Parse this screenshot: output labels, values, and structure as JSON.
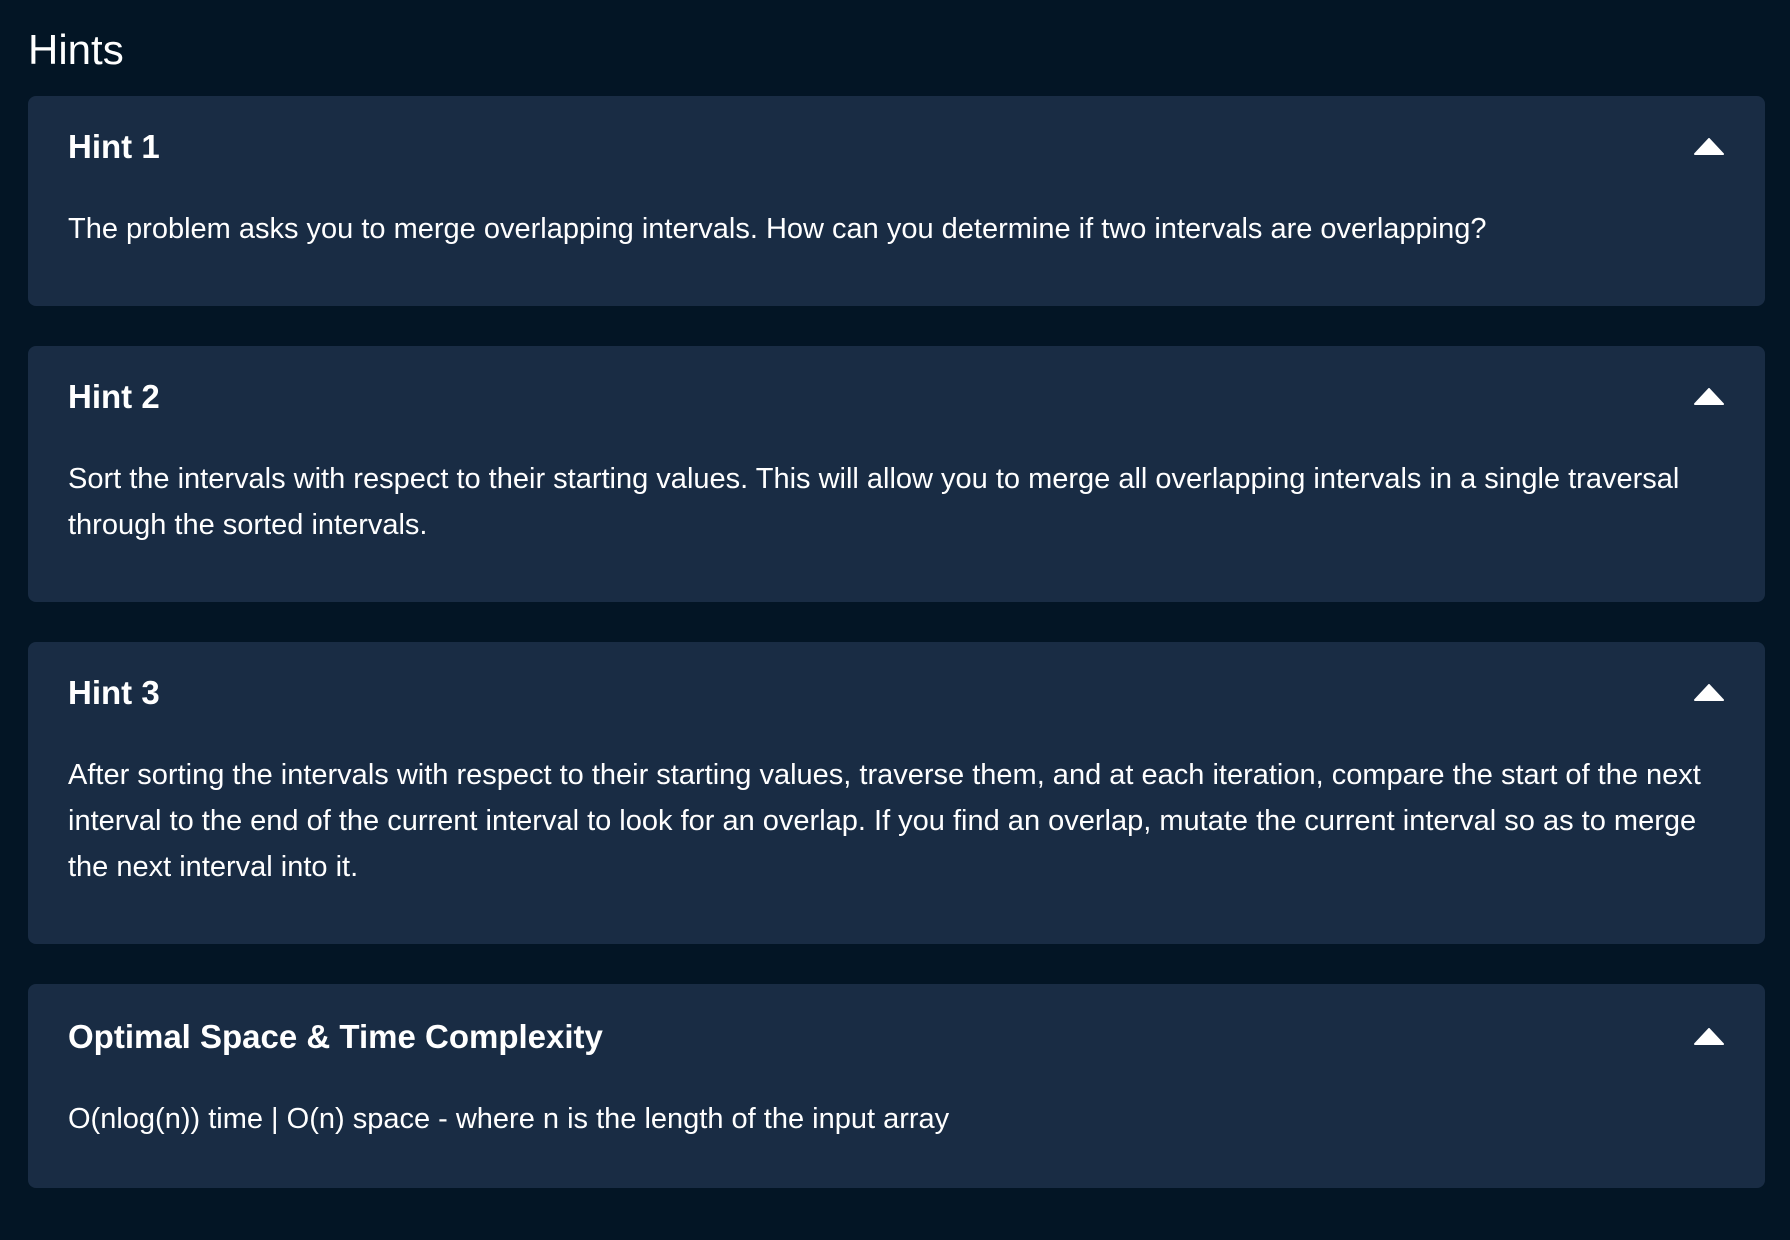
{
  "page": {
    "title": "Hints"
  },
  "hints": [
    {
      "title": "Hint 1",
      "body": "The problem asks you to merge overlapping intervals. How can you determine if two intervals are overlapping?",
      "toggle_icon": "chevron-up-icon"
    },
    {
      "title": "Hint 2",
      "body": "Sort the intervals with respect to their starting values. This will allow you to merge all overlapping intervals in a single traversal through the sorted intervals.",
      "toggle_icon": "chevron-up-icon"
    },
    {
      "title": "Hint 3",
      "body": "After sorting the intervals with respect to their starting values, traverse them, and at each iteration, compare the start of the next interval to the end of the current interval to look for an overlap. If you find an overlap, mutate the current interval so as to merge the next interval into it.",
      "toggle_icon": "chevron-up-icon"
    },
    {
      "title": "Optimal Space & Time Complexity",
      "body": "O(nlog(n)) time | O(n) space - where n is the length of the input array",
      "toggle_icon": "chevron-up-icon"
    }
  ],
  "colors": {
    "background": "#031525",
    "card": "#192c44",
    "text": "#ffffff"
  }
}
